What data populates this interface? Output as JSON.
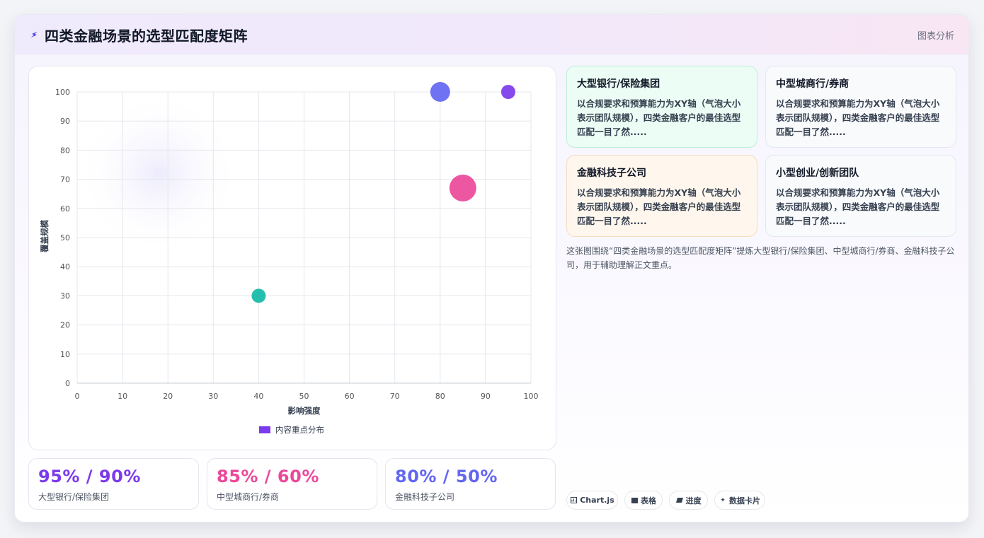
{
  "header": {
    "icon": "lightning-icon",
    "title": "四类金融场景的选型匹配度矩阵",
    "tag": "图表分析"
  },
  "chart_data": {
    "type": "scatter",
    "title": "",
    "xlabel": "影响强度",
    "ylabel": "覆盖规模",
    "xlim": [
      0,
      100
    ],
    "ylim": [
      0,
      100
    ],
    "x_ticks": [
      "0",
      "10",
      "20",
      "30",
      "40",
      "50",
      "60",
      "70",
      "80",
      "90",
      "100"
    ],
    "y_ticks": [
      "0",
      "10",
      "20",
      "30",
      "40",
      "50",
      "60",
      "70",
      "80",
      "90",
      "100"
    ],
    "grid": true,
    "legend_position": "bottom",
    "legend": "内容重点分布",
    "legend_color": "#7c3aed",
    "points": [
      {
        "x": 95,
        "y": 100,
        "r": 10,
        "color": "#7c3aed"
      },
      {
        "x": 85,
        "y": 67,
        "r": 19,
        "color": "#ec4899"
      },
      {
        "x": 80,
        "y": 100,
        "r": 14,
        "color": "#6366f1"
      },
      {
        "x": 40,
        "y": 30,
        "r": 10,
        "color": "#14b8a6"
      }
    ]
  },
  "stats": [
    {
      "value": "95% / 90%",
      "label": "大型银行/保险集团",
      "color": "#7c3aed"
    },
    {
      "value": "85% / 60%",
      "label": "中型城商行/券商",
      "color": "#ec4899"
    },
    {
      "value": "80% / 50%",
      "label": "金融科技子公司",
      "color": "#6366f1"
    }
  ],
  "segments": [
    {
      "title": "大型银行/保险集团",
      "desc": "以合规要求和预算能力为XY轴（气泡大小表示团队规模），四类金融客户的最佳选型匹配一目了然.....",
      "bg": "#ecfdf5",
      "border": "#bbf0d6"
    },
    {
      "title": "中型城商行/券商",
      "desc": "以合规要求和预算能力为XY轴（气泡大小表示团队规模），四类金融客户的最佳选型匹配一目了然.....",
      "bg": "#f8fafc",
      "border": "#e3e7f0"
    },
    {
      "title": "金融科技子公司",
      "desc": "以合规要求和预算能力为XY轴（气泡大小表示团队规模），四类金融客户的最佳选型匹配一目了然.....",
      "bg": "#fff7ed",
      "border": "#f6dcbf"
    },
    {
      "title": "小型创业/创新团队",
      "desc": "以合规要求和预算能力为XY轴（气泡大小表示团队规模），四类金融客户的最佳选型匹配一目了然.....",
      "bg": "#f8fafc",
      "border": "#e3e7f0"
    }
  ],
  "note": "这张图围绕“四类金融场景的选型匹配度矩阵”提炼大型银行/保险集团、中型城商行/券商、金融科技子公司，用于辅助理解正文重点。",
  "pills": [
    {
      "label": "Chart.js",
      "icon": "chart-icon"
    },
    {
      "label": "表格",
      "icon": "table-icon"
    },
    {
      "label": "进度",
      "icon": "progress-icon"
    },
    {
      "label": "数据卡片",
      "icon": "sparkle-icon"
    }
  ]
}
